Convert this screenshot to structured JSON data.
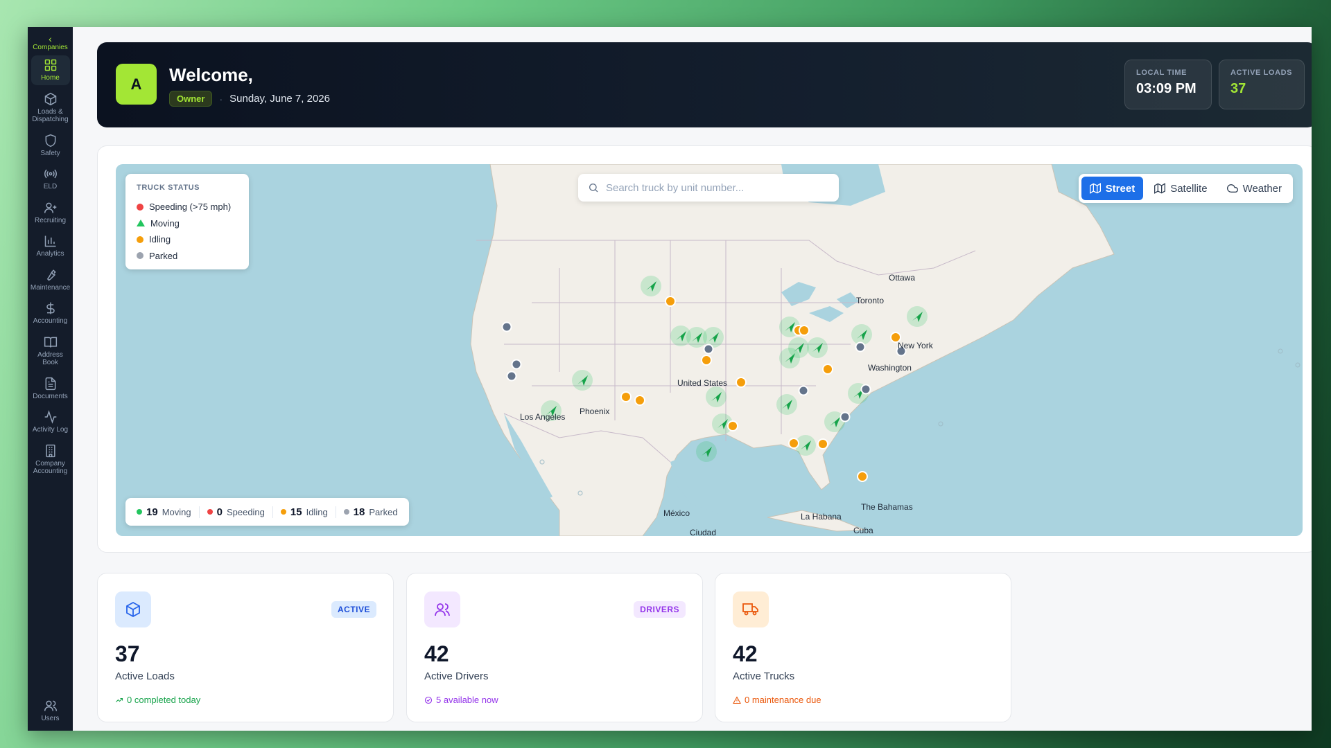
{
  "sidebar": {
    "back_label": "Companies",
    "items": [
      {
        "label": "Home",
        "icon": "grid-icon",
        "active": true
      },
      {
        "label": "Loads & Dispatching",
        "icon": "box-icon"
      },
      {
        "label": "Safety",
        "icon": "shield-icon"
      },
      {
        "label": "ELD",
        "icon": "broadcast-icon"
      },
      {
        "label": "Recruiting",
        "icon": "user-plus-icon"
      },
      {
        "label": "Analytics",
        "icon": "bar-chart-icon"
      },
      {
        "label": "Maintenance",
        "icon": "wrench-icon"
      },
      {
        "label": "Accounting",
        "icon": "dollar-icon"
      },
      {
        "label": "Address Book",
        "icon": "book-icon"
      },
      {
        "label": "Documents",
        "icon": "document-icon"
      },
      {
        "label": "Activity Log",
        "icon": "activity-icon"
      },
      {
        "label": "Company Accounting",
        "icon": "building-icon"
      }
    ],
    "bottom_item": {
      "label": "Users",
      "icon": "users-icon"
    }
  },
  "header": {
    "avatar_letter": "A",
    "welcome": "Welcome,",
    "role": "Owner",
    "separator": "·",
    "date": "Sunday, June 7, 2026",
    "local_time_label": "LOCAL TIME",
    "local_time": "03:09 PM",
    "active_loads_label": "ACTIVE LOADS",
    "active_loads": "37"
  },
  "map": {
    "legend_title": "TRUCK STATUS",
    "legend": [
      {
        "label": "Speeding (>75 mph)",
        "color": "#ef4444",
        "shape": "dot"
      },
      {
        "label": "Moving",
        "color": "#22c55e",
        "shape": "triangle"
      },
      {
        "label": "Idling",
        "color": "#f59e0b",
        "shape": "dot"
      },
      {
        "label": "Parked",
        "color": "#9ca3af",
        "shape": "dot"
      }
    ],
    "search_placeholder": "Search truck by unit number...",
    "views": [
      {
        "label": "Street",
        "active": true,
        "icon": "map-icon"
      },
      {
        "label": "Satellite",
        "active": false,
        "icon": "map-icon"
      },
      {
        "label": "Weather",
        "active": false,
        "icon": "cloud-icon"
      }
    ],
    "counts": [
      {
        "value": "19",
        "label": "Moving",
        "color": "#22c55e"
      },
      {
        "value": "0",
        "label": "Speeding",
        "color": "#ef4444"
      },
      {
        "value": "15",
        "label": "Idling",
        "color": "#f59e0b"
      },
      {
        "value": "18",
        "label": "Parked",
        "color": "#9ca3af"
      }
    ],
    "cities": {
      "ottawa": "Ottawa",
      "toronto": "Toronto",
      "newyork": "New York",
      "washington": "Washington",
      "us": "United States",
      "phoenix": "Phoenix",
      "la": "Los Angeles",
      "mexico": "México",
      "ciudad": "Ciudad",
      "habana": "La Habana",
      "bahamas": "The Bahamas",
      "cuba": "Cuba"
    }
  },
  "cards": [
    {
      "tag": "ACTIVE",
      "value": "37",
      "name": "Active Loads",
      "sub": "0 completed today",
      "icon": "box-icon",
      "accent": "#2563eb",
      "bg": "#dbeafe",
      "subcolor": "#16a34a"
    },
    {
      "tag": "DRIVERS",
      "value": "42",
      "name": "Active Drivers",
      "sub": "5 available now",
      "icon": "users-icon",
      "accent": "#9333ea",
      "bg": "#f3e8ff",
      "subcolor": "#9333ea"
    },
    {
      "tag": "",
      "value": "42",
      "name": "Active Trucks",
      "sub": "0 maintenance due",
      "icon": "truck-icon",
      "accent": "#ea580c",
      "bg": "#ffedd5",
      "subcolor": "#ea580c"
    }
  ]
}
